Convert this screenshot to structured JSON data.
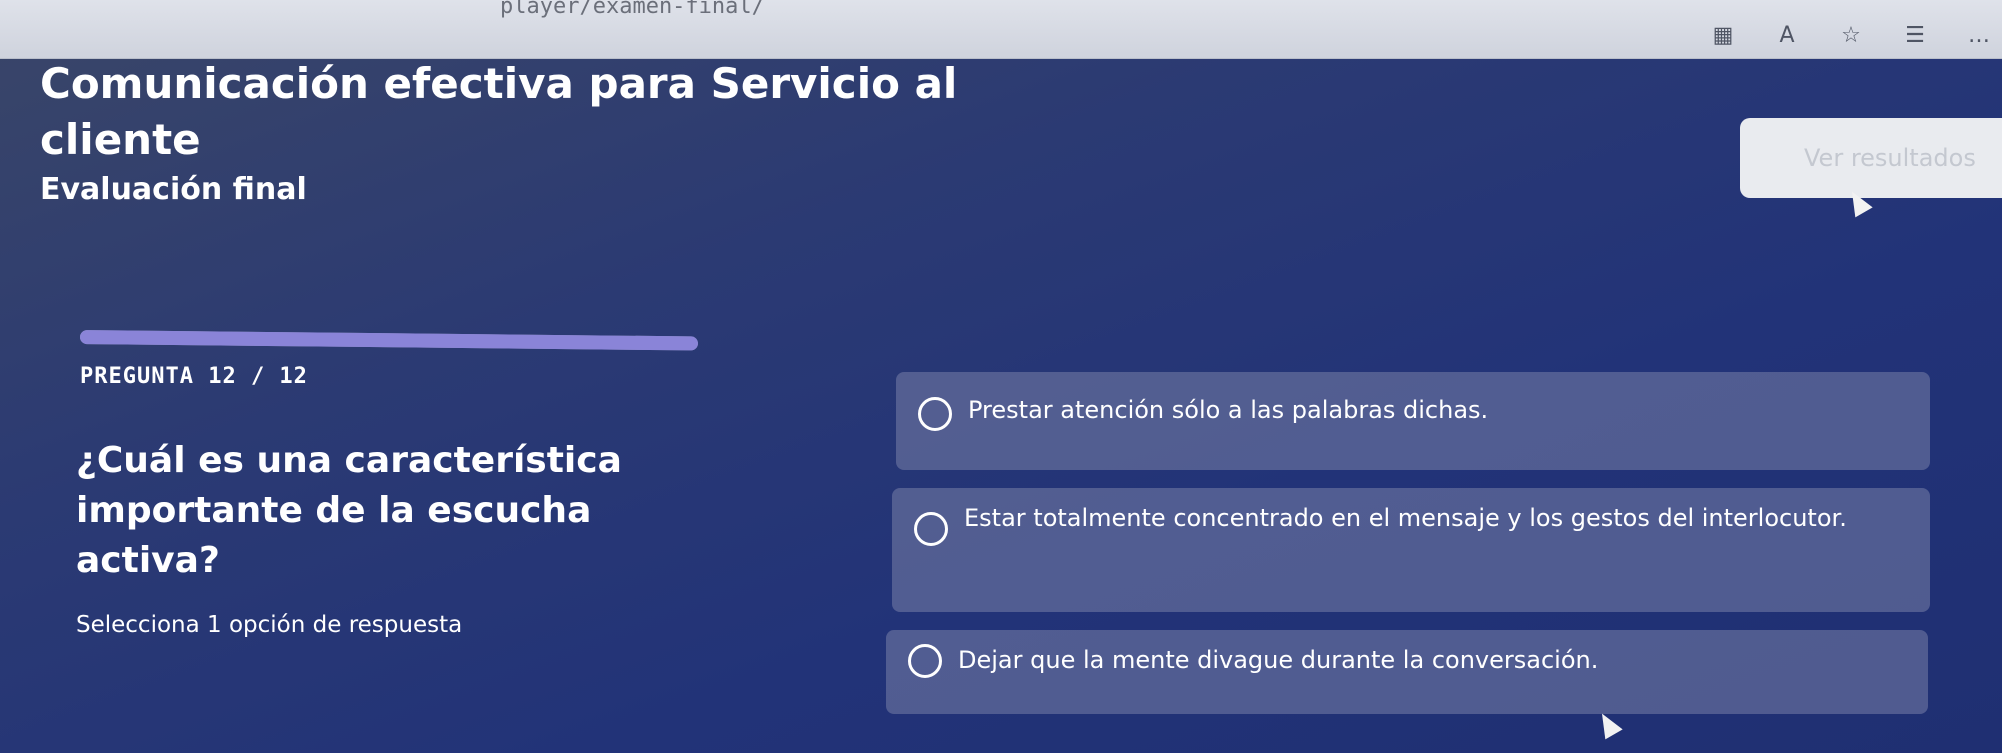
{
  "browser": {
    "url": "player/examen-final/",
    "icons": [
      "reader-view-icon",
      "read-aloud-icon",
      "favorite-star-icon",
      "favorites-list-icon",
      "more-icon"
    ]
  },
  "header": {
    "title": "Comunicación efectiva para Servicio al cliente",
    "subtitle": "Evaluación final",
    "results_button": "Ver resultados"
  },
  "progress": {
    "current": 12,
    "total": 12,
    "fraction": 1.0
  },
  "question": {
    "counter": "PREGUNTA 12 / 12",
    "text": "¿Cuál es una característica importante de la escucha activa?",
    "instruction": "Selecciona 1 opción de respuesta"
  },
  "options": [
    {
      "label": "Prestar atención sólo a las palabras dichas."
    },
    {
      "label": "Estar totalmente concentrado en el mensaje y los gestos del interlocutor."
    },
    {
      "label": "Dejar que la mente divague durante la conversación."
    }
  ],
  "colors": {
    "background": "#223378",
    "option_bg": "#7880a8",
    "progress_fill": "#8a84d8",
    "progress_track": "#8f93b3"
  }
}
